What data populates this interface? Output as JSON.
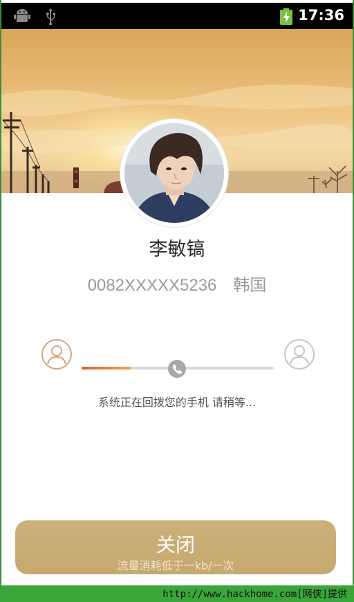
{
  "status_bar": {
    "time": "17:36",
    "icons": [
      "android-icon",
      "usb-icon",
      "battery-charging-icon"
    ]
  },
  "contact": {
    "name": "李敏镐",
    "phone": "0082XXXXX5236",
    "country": "韩国"
  },
  "call_progress": {
    "progress_fraction": 0.26,
    "icons": [
      "caller-user-icon",
      "phone-icon",
      "callee-user-icon"
    ],
    "status_text": "系统正在回拨您的手机 请稍等..."
  },
  "close_button": {
    "label": "关闭",
    "sublabel": "流量消耗低于一kb/一次"
  },
  "watermark": {
    "text": "http://www.hackhome.com[网侠]提供"
  },
  "colors": {
    "accent_gold": "#c6a96f",
    "progress_start": "#d9633a",
    "progress_end": "#f0a640",
    "footer_green": "#3aa63a"
  }
}
